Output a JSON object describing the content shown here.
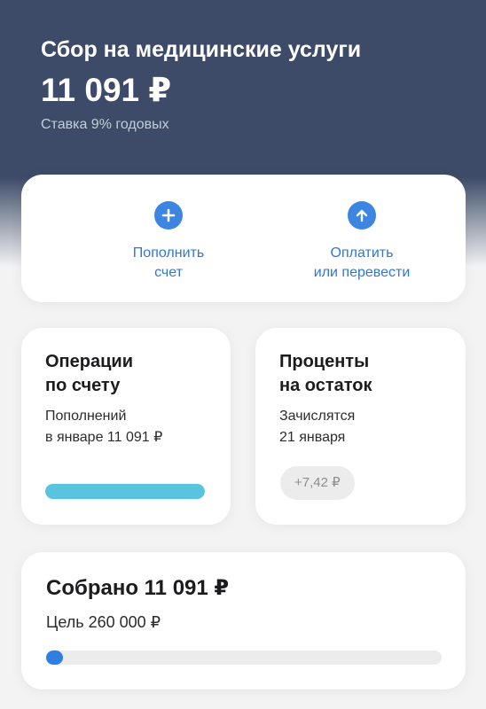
{
  "header": {
    "title": "Сбор на медицинские услуги",
    "amount": "11 091 ₽",
    "rate": "Ставка 9% годовых"
  },
  "actions": {
    "topup": {
      "label": "Пополнить\nсчет",
      "icon": "plus-icon"
    },
    "pay": {
      "label": "Оплатить\nили перевести",
      "icon": "arrow-up-icon"
    }
  },
  "operations": {
    "title": "Операции\nпо счету",
    "text": "Пополнений\nв январе 11 091 ₽",
    "progress_fraction": 1.0,
    "bar_color": "#58c4df"
  },
  "interest": {
    "title": "Проценты\nна остаток",
    "text": "Зачислятся\n21 января",
    "amount": "+7,42 ₽"
  },
  "goal": {
    "collected": "Собрано 11 091 ₽",
    "target": "Цель 260 000 ₽",
    "progress_fraction": 0.0427,
    "bar_color": "#2f7fe2"
  },
  "colors": {
    "header_bg": "#3e4b68",
    "accent": "#3c85e0"
  }
}
